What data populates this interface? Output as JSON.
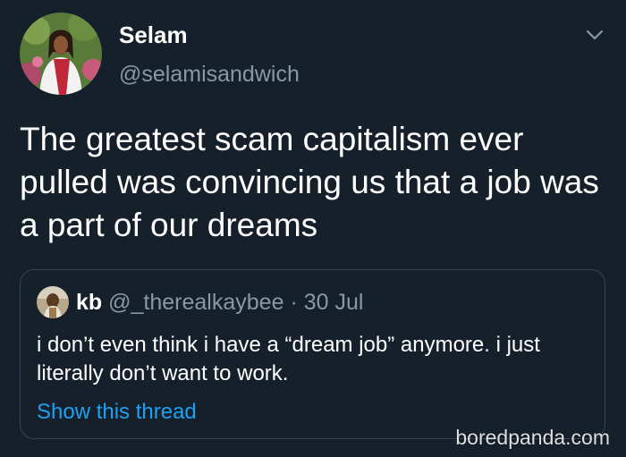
{
  "author": {
    "display_name": "Selam",
    "handle": "@selamisandwich",
    "avatar_icon": "profile-photo"
  },
  "menu": {
    "icon": "chevron-down-icon"
  },
  "tweet": {
    "text": "The greatest scam capitalism ever pulled was convincing us that a job was a part of our dreams"
  },
  "quoted_tweet": {
    "display_name": "kb",
    "handle": "@_therealkaybee",
    "separator": "·",
    "date": "30 Jul",
    "text": "i don’t even think i have a “dream job” anymore. i just literally don’t want to work.",
    "show_thread_label": "Show this thread"
  },
  "watermark": "boredpanda.com",
  "colors": {
    "background": "#15202b",
    "secondary_text": "#8899a6",
    "link": "#1da1f2",
    "border": "#38444d"
  }
}
